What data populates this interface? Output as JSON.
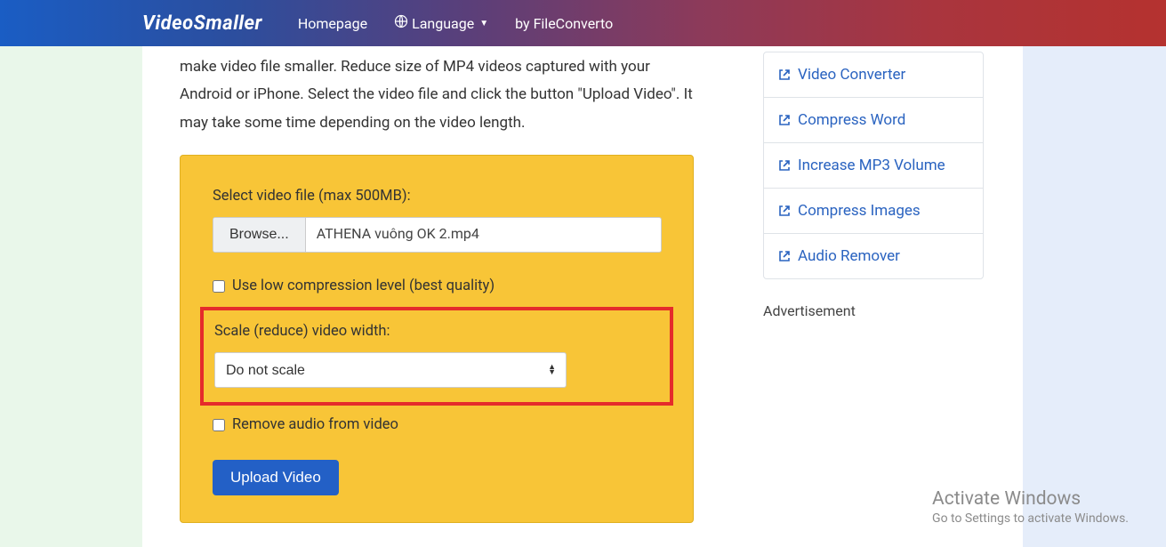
{
  "nav": {
    "brand": "VideoSmaller",
    "homepage": "Homepage",
    "language": "Language",
    "by": "by FileConverto"
  },
  "intro": "make video file smaller. Reduce size of MP4 videos captured with your Android or iPhone. Select the video file and click the button \"Upload Video\". It may take some time depending on the video length.",
  "form": {
    "select_label": "Select video file (max 500MB):",
    "browse": "Browse...",
    "filename": "ATHENA vuông OK 2.mp4",
    "low_comp": "Use low compression level (best quality)",
    "scale_label": "Scale (reduce) video width:",
    "scale_value": "Do not scale",
    "remove_audio": "Remove audio from video",
    "upload": "Upload Video"
  },
  "sidebar": {
    "items": [
      "Video Converter",
      "Compress Word",
      "Increase MP3 Volume",
      "Compress Images",
      "Audio Remover"
    ],
    "ad": "Advertisement"
  },
  "watermark": {
    "title": "Activate Windows",
    "sub": "Go to Settings to activate Windows."
  }
}
